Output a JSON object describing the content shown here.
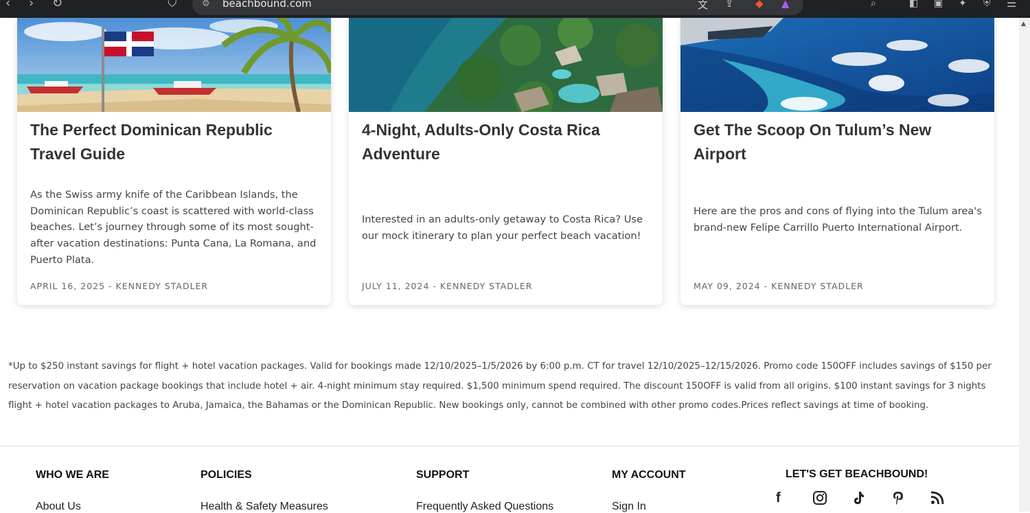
{
  "browser": {
    "url": "beachbound.com",
    "icons": [
      "back-icon",
      "forward-icon",
      "reload-icon",
      "bookmark-icon",
      "site-info-icon",
      "translate-icon",
      "share-icon",
      "brave-shield-icon",
      "brave-rewards-icon",
      "search-icon",
      "sidebar-icon",
      "tabs-icon",
      "leo-icon",
      "vpn-icon",
      "menu-icon"
    ]
  },
  "cards": [
    {
      "title": "The Perfect Dominican Republic Travel Guide",
      "description": "As the Swiss army knife of the Caribbean Islands, the Dominican Republic’s coast is scattered with world-class beaches. Let’s journey through some of its most sought-after vacation destinations: Punta Cana, La Romana, and Puerto Plata.",
      "date": "APRIL 16, 2025",
      "author": "KENNEDY STADLER"
    },
    {
      "title": "4-Night, Adults-Only Costa Rica Adventure",
      "description": "Interested in an adults-only getaway to Costa Rica? Use our mock itinerary to plan your perfect beach vacation!",
      "date": "JULY 11, 2024",
      "author": "KENNEDY STADLER"
    },
    {
      "title": "Get The Scoop On Tulum’s New Airport",
      "description": "Here are the pros and cons of flying into the Tulum area's brand-new Felipe Carrillo Puerto International Airport.",
      "date": "MAY 09, 2024",
      "author": "KENNEDY STADLER"
    }
  ],
  "meta_separator": "-",
  "disclaimer": "*Up to $250 instant savings for flight + hotel vacation packages. Valid for bookings made 12/10/2025–1/5/2026 by 6:00 p.m. CT for travel 12/10/2025–12/15/2026. Promo code 150OFF includes savings of $150 per reservation on vacation package bookings that include hotel + air. 4-night minimum stay required. $1,500 minimum spend required. The discount 150OFF is valid from all origins. $100 instant savings for 3 nights flight + hotel vacation packages to Aruba, Jamaica, the Bahamas or the Dominican Republic. New bookings only, cannot be combined with other promo codes.Prices reflect savings at time of booking.",
  "footer": {
    "columns": [
      {
        "title": "WHO WE ARE",
        "first_link": "About Us"
      },
      {
        "title": "POLICIES",
        "first_link": "Health & Safety Measures"
      },
      {
        "title": "SUPPORT",
        "first_link": "Frequently Asked Questions"
      },
      {
        "title": "MY ACCOUNT",
        "first_link": "Sign In"
      }
    ],
    "social_title": "LET'S GET BEACHBOUND!",
    "social_icons": [
      "facebook-icon",
      "instagram-icon",
      "tiktok-icon",
      "pinterest-icon",
      "rss-icon"
    ]
  }
}
